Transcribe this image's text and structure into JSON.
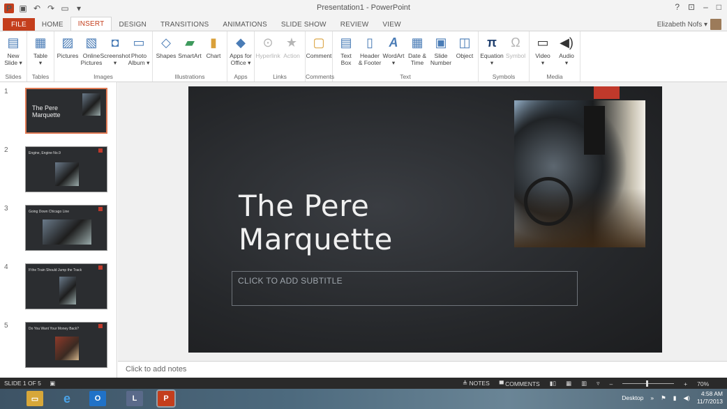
{
  "window": {
    "title": "Presentation1 - PowerPoint",
    "controls": [
      "?",
      "⊡",
      "–",
      "□"
    ]
  },
  "tabs": [
    "FILE",
    "HOME",
    "INSERT",
    "DESIGN",
    "TRANSITIONS",
    "ANIMATIONS",
    "SLIDE SHOW",
    "REVIEW",
    "VIEW"
  ],
  "active_tab": "INSERT",
  "user": {
    "name": "Elizabeth Nofs ▾"
  },
  "ribbon": {
    "slides": {
      "label": "Slides",
      "buttons": [
        "New\nSlide ▾"
      ]
    },
    "tables": {
      "label": "Tables",
      "buttons": [
        "Table\n▾"
      ]
    },
    "images": {
      "label": "Images",
      "buttons": [
        "Pictures",
        "Online\nPictures",
        "Screenshot\n▾",
        "Photo\nAlbum ▾"
      ]
    },
    "illustrations": {
      "label": "Illustrations",
      "buttons": [
        "Shapes",
        "SmartArt",
        "Chart"
      ]
    },
    "apps": {
      "label": "Apps",
      "buttons": [
        "Apps for\nOffice ▾"
      ]
    },
    "links": {
      "label": "Links",
      "buttons": [
        "Hyperlink",
        "Action"
      ]
    },
    "comments": {
      "label": "Comments",
      "buttons": [
        "Comment"
      ]
    },
    "text": {
      "label": "Text",
      "buttons": [
        "Text\nBox",
        "Header\n& Footer",
        "WordArt\n▾",
        "Date &\nTime",
        "Slide\nNumber",
        "Object"
      ]
    },
    "symbols": {
      "label": "Symbols",
      "buttons": [
        "Equation\n▾",
        "Symbol"
      ]
    },
    "media": {
      "label": "Media",
      "buttons": [
        "Video\n▾",
        "Audio\n▾"
      ]
    }
  },
  "thumbnails": [
    {
      "num": "1",
      "title": "",
      "big": "The Pere\nMarquette"
    },
    {
      "num": "2",
      "title": "Engine, Engine No.9",
      "big": ""
    },
    {
      "num": "3",
      "title": "Going Down Chicago Line",
      "big": ""
    },
    {
      "num": "4",
      "title": "If the Train Should Jump the Track",
      "big": ""
    },
    {
      "num": "5",
      "title": "Do You Want Your Money Back?",
      "big": ""
    }
  ],
  "slide": {
    "title_line1": "The Pere",
    "title_line2": "Marquette",
    "subtitle_placeholder": "CLICK TO ADD SUBTITLE"
  },
  "notes": {
    "placeholder": "Click to add notes"
  },
  "status": {
    "slide_count": "SLIDE 1 OF 5",
    "notes": "≜ NOTES",
    "comments": "▀ COMMENTS",
    "zoom": "70%"
  },
  "taskbar": {
    "desktop": "Desktop",
    "time": "4:58 AM",
    "date": "11/7/2013"
  },
  "colors": {
    "accent": "#c43e1c",
    "slide_bg": "#26282b",
    "red_block": "#c0392b"
  }
}
